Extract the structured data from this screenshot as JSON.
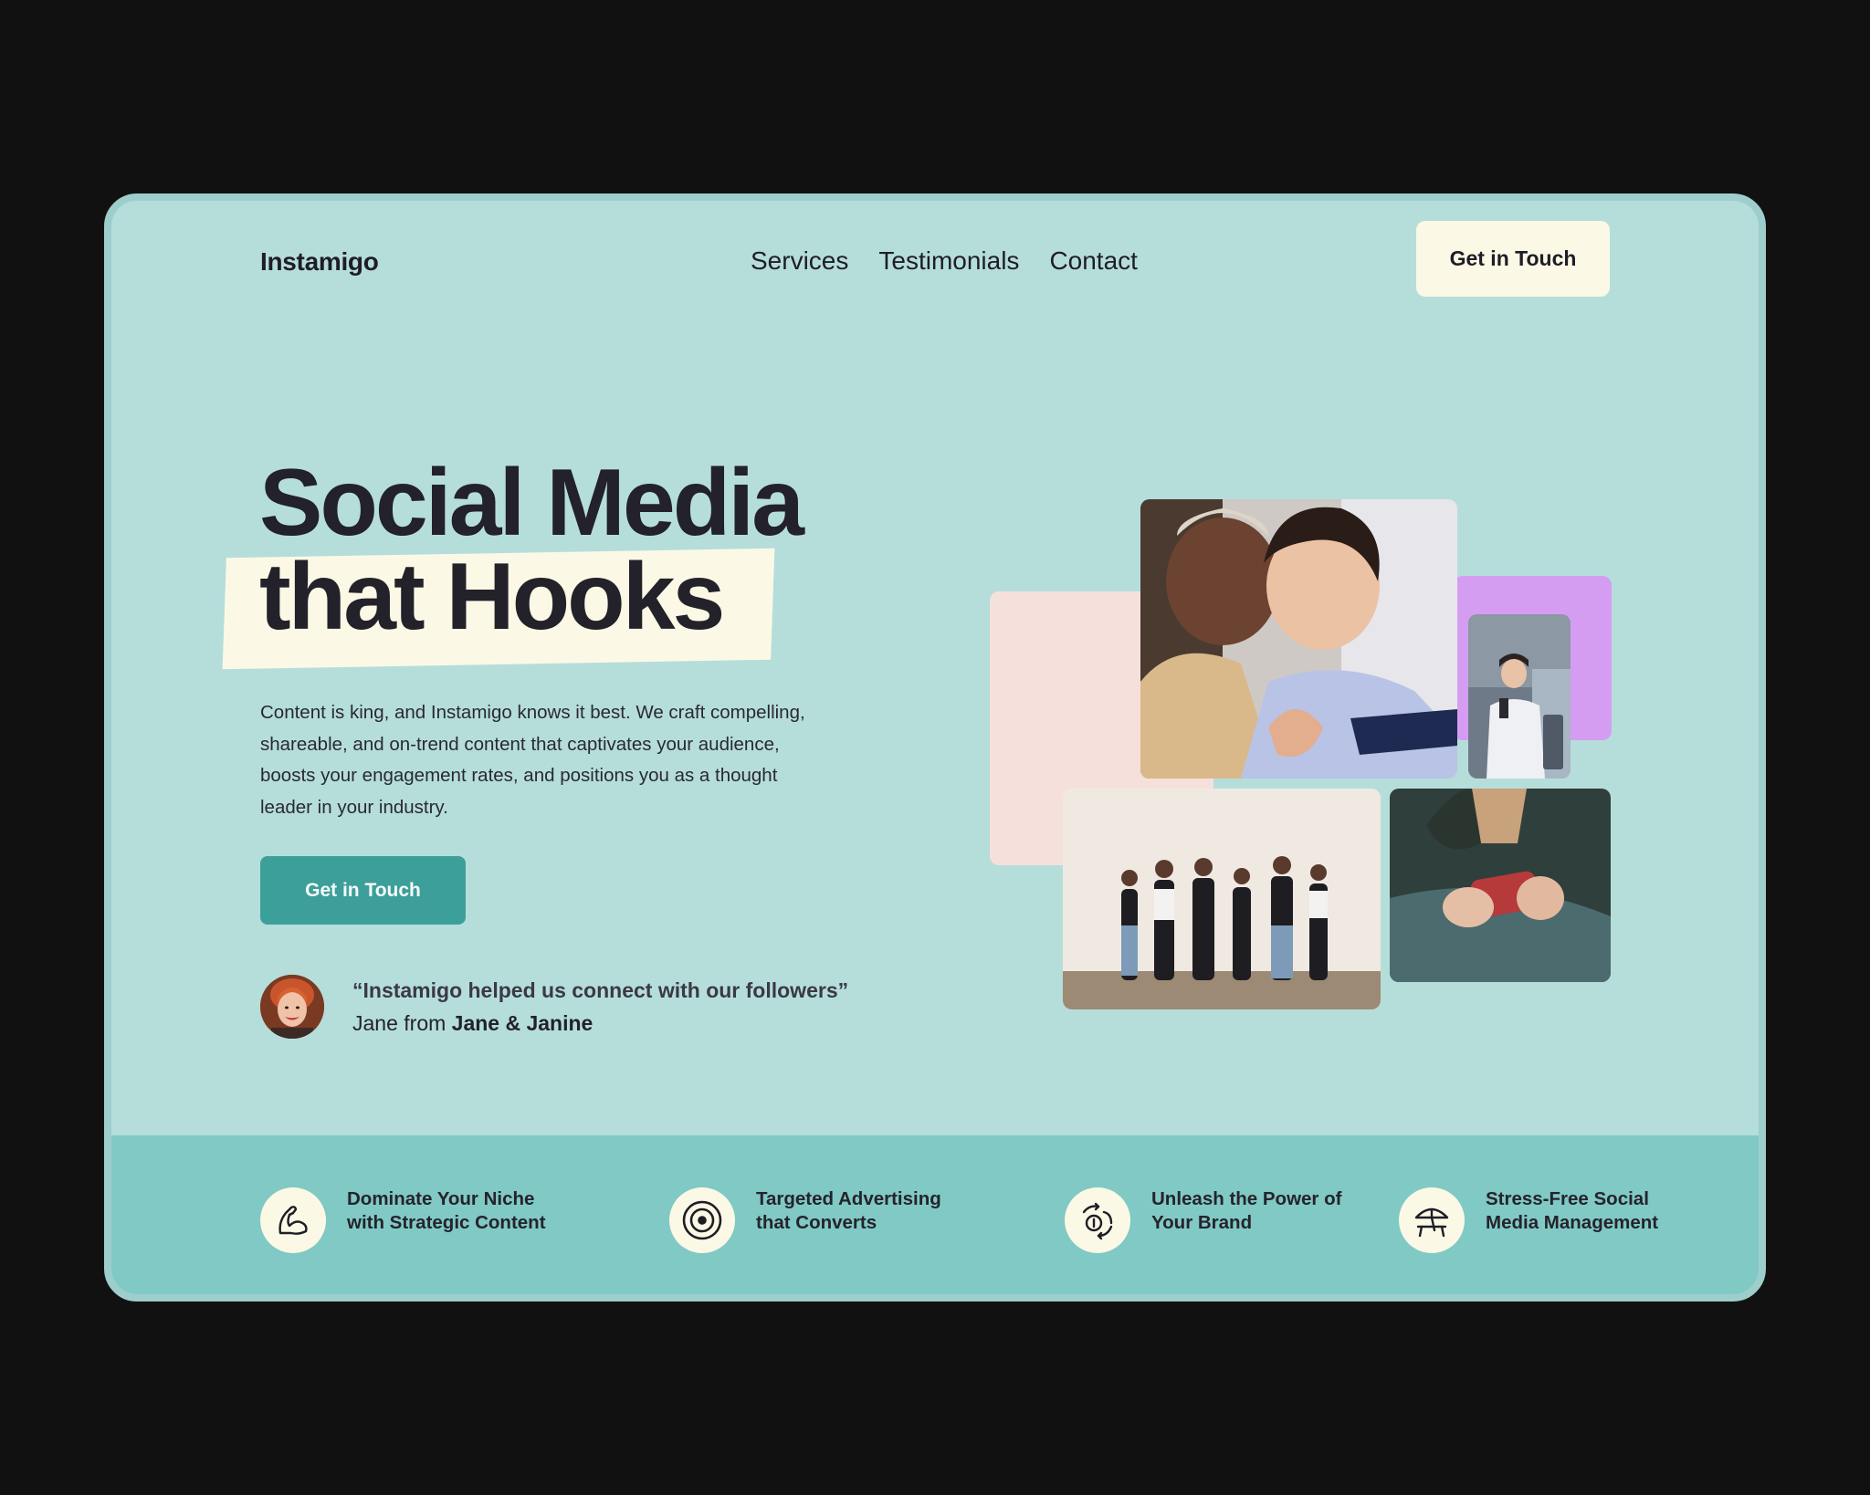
{
  "nav": {
    "logo": "Instamigo",
    "links": [
      "Services",
      "Testimonials",
      "Contact"
    ],
    "cta": "Get in Touch"
  },
  "hero": {
    "title_line1": "Social Media",
    "title_line2": "that Hooks",
    "description": "Content is king, and Instamigo knows it best. We craft compelling, shareable, and on-trend content that captivates your audience, boosts your engagement rates, and positions you as a thought leader in your industry.",
    "cta": "Get in Touch"
  },
  "testimonial": {
    "quote": "“Instamigo helped us connect with our followers”",
    "author_prefix": "Jane from ",
    "author_company": "Jane & Janine"
  },
  "features": [
    {
      "icon": "flexed-arm-icon",
      "label": "Dominate Your Niche with Strategic Content"
    },
    {
      "icon": "target-icon",
      "label": "Targeted Advertising that Converts"
    },
    {
      "icon": "money-cycle-icon",
      "label": "Unleash the Power of Your Brand"
    },
    {
      "icon": "beach-umbrella-icon",
      "label": "Stress-Free Social Media Management"
    }
  ],
  "colors": {
    "background": "#111111",
    "frame": "#b5dedb",
    "cream": "#fbf9e6",
    "teal_button": "#3d9f9a",
    "feature_band": "#80c9c5",
    "pink_block": "#f6e0dc",
    "purple_block": "#d59df2"
  }
}
